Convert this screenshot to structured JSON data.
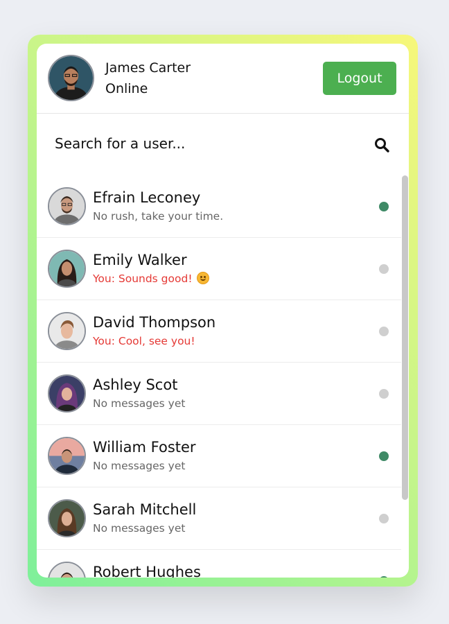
{
  "current_user": {
    "name": "James Carter",
    "status": "Online",
    "avatar": "avatar-james-carter"
  },
  "header": {
    "logout_label": "Logout"
  },
  "search": {
    "label": "Search for a user...",
    "icon": "search-icon"
  },
  "colors": {
    "online": "#3f8a66",
    "offline": "#cfcfcf",
    "logout_bg": "#4caf50",
    "own_message": "#e53935"
  },
  "users": [
    {
      "name": "Efrain Leconey",
      "message": "No rush, take your time.",
      "mine": false,
      "online": true,
      "emoji": false
    },
    {
      "name": "Emily Walker",
      "message": "You: Sounds good!",
      "mine": true,
      "online": false,
      "emoji": true
    },
    {
      "name": "David Thompson",
      "message": "You: Cool, see you!",
      "mine": true,
      "online": false,
      "emoji": false
    },
    {
      "name": "Ashley Scot",
      "message": "No messages yet",
      "mine": false,
      "online": false,
      "emoji": false
    },
    {
      "name": "William Foster",
      "message": "No messages yet",
      "mine": false,
      "online": true,
      "emoji": false
    },
    {
      "name": "Sarah Mitchell",
      "message": "No messages yet",
      "mine": false,
      "online": false,
      "emoji": false
    },
    {
      "name": "Robert Hughes",
      "message": "",
      "mine": false,
      "online": true,
      "emoji": false
    }
  ]
}
